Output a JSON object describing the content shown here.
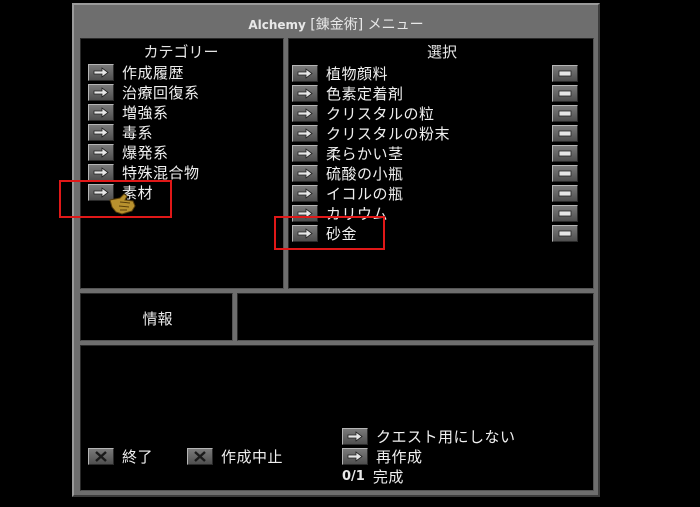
{
  "window": {
    "title_latin": "Alchemy",
    "title_jp": "[錬金術] メニュー"
  },
  "category": {
    "header": "カテゴリー",
    "items": [
      {
        "label": "作成履歴"
      },
      {
        "label": "治療回復系"
      },
      {
        "label": "増強系"
      },
      {
        "label": "毒系"
      },
      {
        "label": "爆発系"
      },
      {
        "label": "特殊混合物"
      },
      {
        "label": "素材"
      }
    ]
  },
  "selection": {
    "header": "選択",
    "items": [
      {
        "label": "植物顔料"
      },
      {
        "label": "色素定着剤"
      },
      {
        "label": "クリスタルの粒"
      },
      {
        "label": "クリスタルの粉末"
      },
      {
        "label": "柔らかい茎"
      },
      {
        "label": "硫酸の小瓶"
      },
      {
        "label": "イコルの瓶"
      },
      {
        "label": "カリウム"
      },
      {
        "label": "砂金"
      }
    ]
  },
  "info": {
    "label": "情報",
    "value": ""
  },
  "footer": {
    "quit_label": "終了",
    "cancel_label": "作成中止",
    "no_quest_label": "クエスト用にしない",
    "recreate_label": "再作成",
    "progress_count": "0/1",
    "progress_label": "完成"
  },
  "highlight_color": "#e01818"
}
